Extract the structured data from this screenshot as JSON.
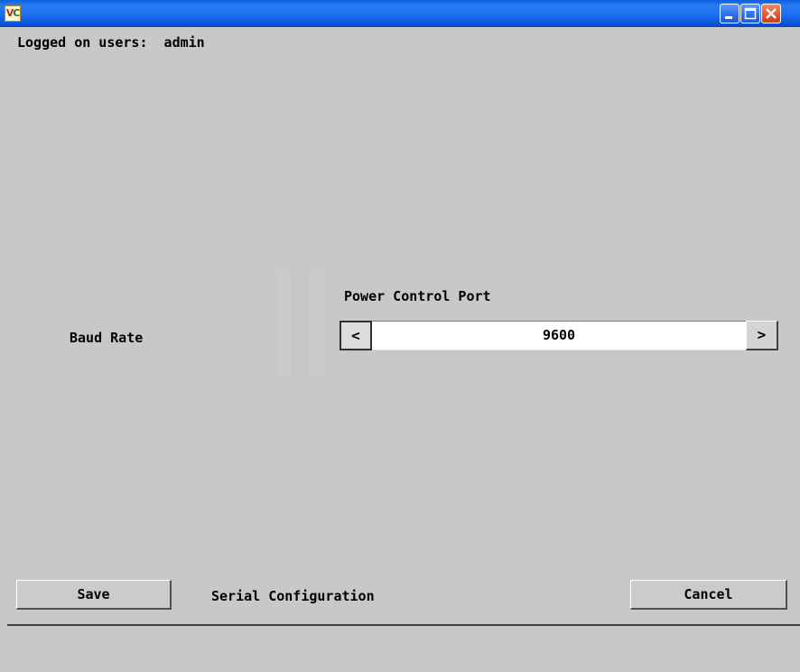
{
  "window": {
    "app_icon_text_v": "V",
    "app_icon_text_c": "C",
    "controls": [
      "minimize",
      "maximize",
      "close"
    ]
  },
  "session": {
    "logged_on_label": "Logged on users:  admin"
  },
  "serial": {
    "port_heading": "Power Control Port",
    "baud_label": "Baud Rate",
    "baud_value": "9600",
    "prev_symbol": "<",
    "next_symbol": ">"
  },
  "footer": {
    "save_label": "Save",
    "title": "Serial Configuration",
    "cancel_label": "Cancel"
  },
  "colors": {
    "titlebar": "#1c6ef0",
    "background": "#c8c8c8",
    "close_button": "#e15a32"
  }
}
